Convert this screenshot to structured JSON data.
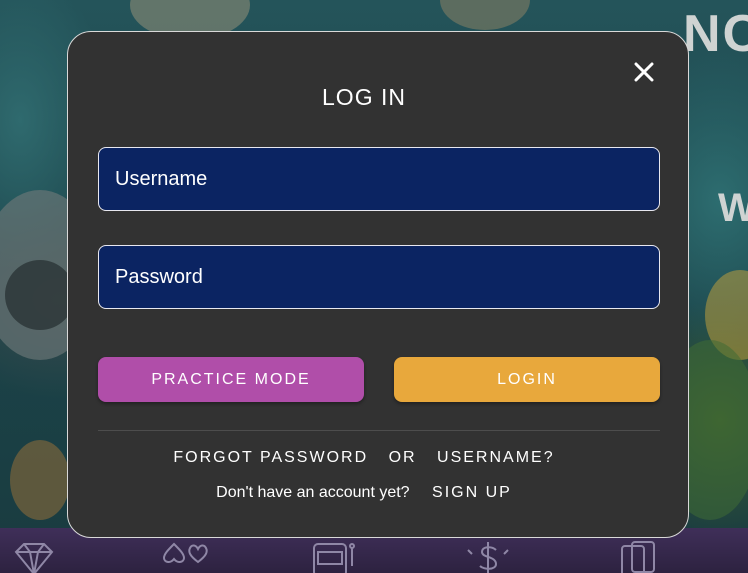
{
  "modal": {
    "title": "LOG IN",
    "close_icon": "close-icon",
    "username_placeholder": "Username",
    "password_placeholder": "Password",
    "practice_label": "PRACTICE MODE",
    "login_label": "LOGIN",
    "forgot_password": "FORGOT PASSWORD",
    "or_text": "OR",
    "forgot_username": "USERNAME?",
    "no_account_text": "Don't have an account yet?",
    "signup_label": "SIGN UP"
  },
  "background": {
    "partial_text_top": "NO",
    "partial_text_mid": "W"
  },
  "bottom_nav": {
    "icons": [
      "diamond-icon",
      "card-suits-icon",
      "slot-machine-icon",
      "dollar-icon",
      "cards-icon"
    ]
  },
  "colors": {
    "modal_bg": "#323232",
    "input_bg": "#0b2462",
    "practice_button": "#b04ea9",
    "login_button": "#e8a83c",
    "bottom_bar": "#3f2f59"
  }
}
